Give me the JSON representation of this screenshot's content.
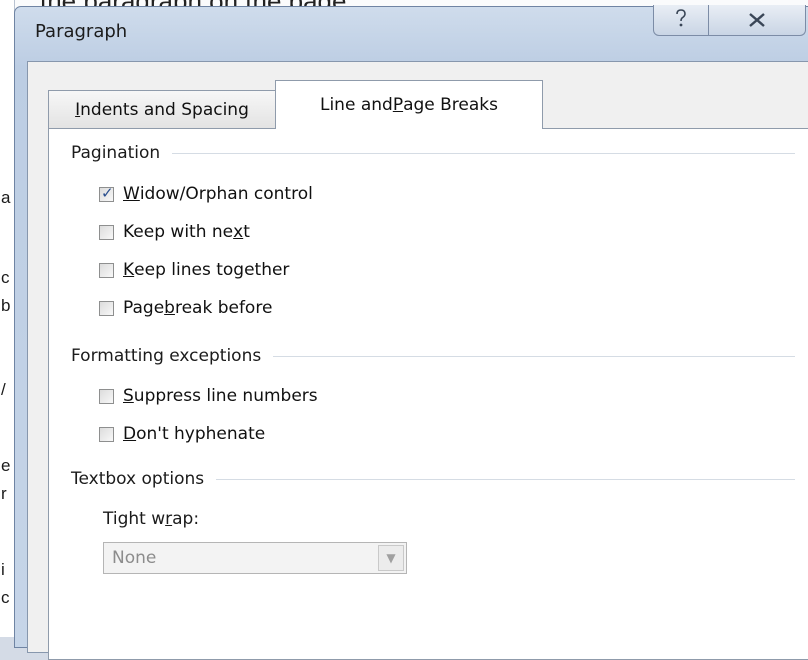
{
  "background": {
    "partial_text": "the paragraph on the page",
    "left_letters": [
      "a",
      "c",
      "b",
      "/",
      "e",
      "r",
      "i",
      "c"
    ]
  },
  "dialog": {
    "title": "Paragraph",
    "help_icon": "help-icon",
    "close_icon": "close-icon"
  },
  "tabs": [
    {
      "label_pre": "",
      "label_u": "I",
      "label_post": "ndents and Spacing",
      "active": false
    },
    {
      "label_pre": "Line and ",
      "label_u": "P",
      "label_post": "age Breaks",
      "active": true
    }
  ],
  "pagination": {
    "header": "Pagination",
    "options": [
      {
        "pre": "",
        "u": "W",
        "post": "idow/Orphan control",
        "checked": true
      },
      {
        "pre": "Keep with ne",
        "u": "x",
        "post": "t",
        "checked": false
      },
      {
        "pre": "",
        "u": "K",
        "post": "eep lines together",
        "checked": false
      },
      {
        "pre": "Page ",
        "u": "b",
        "post": "reak before",
        "checked": false
      }
    ]
  },
  "formatting": {
    "header": "Formatting exceptions",
    "options": [
      {
        "pre": "",
        "u": "S",
        "post": "uppress line numbers",
        "checked": false
      },
      {
        "pre": "",
        "u": "D",
        "post": "on't hyphenate",
        "checked": false
      }
    ]
  },
  "textbox": {
    "header": "Textbox options",
    "tight_wrap_pre": "Tight w",
    "tight_wrap_u": "r",
    "tight_wrap_post": "ap:",
    "tight_wrap_value": "None"
  },
  "colors": {
    "check_mark": "#2a4f8e",
    "panel_bg": "#ffffff",
    "disabled_text": "#8c8c8c"
  }
}
